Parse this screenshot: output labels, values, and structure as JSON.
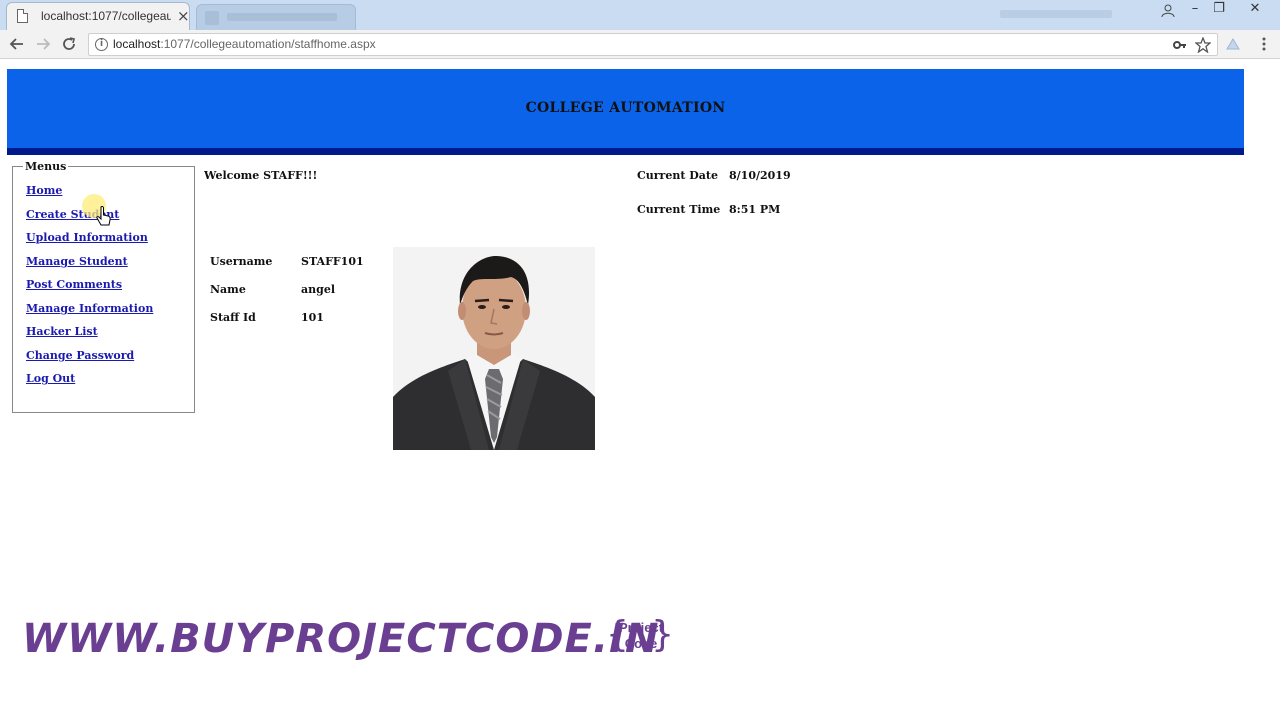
{
  "browser": {
    "tab_title": "localhost:1077/collegeau",
    "tab_close": "×",
    "url_host": "localhost",
    "url_path": ":1077/collegeautomation/staffhome.aspx",
    "window_controls": [
      "–",
      "❐",
      "✕"
    ]
  },
  "header": {
    "title": "COLLEGE AUTOMATION",
    "bg_color": "#0a63e8",
    "bar_color": "#001a8c"
  },
  "menu": {
    "legend": "Menus",
    "items": [
      {
        "label": "Home"
      },
      {
        "label": "Create Student"
      },
      {
        "label": "Upload Information"
      },
      {
        "label": "Manage Student"
      },
      {
        "label": "Post Comments"
      },
      {
        "label": "Manage Information"
      },
      {
        "label": "Hacker List"
      },
      {
        "label": "Change Password"
      },
      {
        "label": "Log Out"
      }
    ],
    "link_color": "#1a1ab0"
  },
  "welcome": "Welcome STAFF!!!",
  "current": {
    "date_label": "Current Date",
    "date_value": "8/10/2019",
    "time_label": "Current Time",
    "time_value": "8:51 PM"
  },
  "profile": {
    "username_label": "Username",
    "username_value": "STAFF101",
    "name_label": "Name",
    "name_value": "angel",
    "staffid_label": "Staff Id",
    "staffid_value": "101"
  },
  "watermark": {
    "text": "WWW.BUYPROJECTCODE.IN",
    "logo_line1": "Project",
    "logo_line2": "Code",
    "color": "#6a3f92"
  }
}
